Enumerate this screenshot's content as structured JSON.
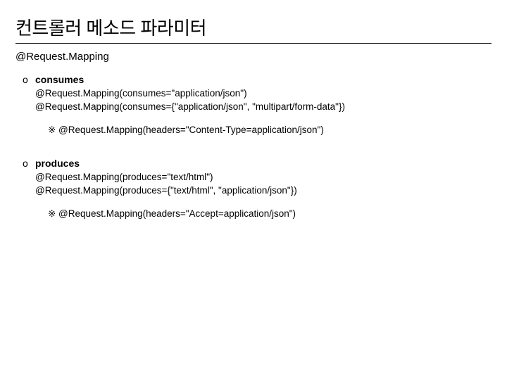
{
  "title": "컨트롤러 메소드 파라미터",
  "subtitle": "@Request.Mapping",
  "sections": [
    {
      "bullet": "o",
      "heading": "consumes",
      "lines": [
        "@Request.Mapping(consumes=\"application/json\")",
        "@Request.Mapping(consumes={\"application/json\", \"multipart/form-data\"})"
      ],
      "note": "※ @Request.Mapping(headers=\"Content-Type=application/json\")"
    },
    {
      "bullet": "o",
      "heading": "produces",
      "lines": [
        "@Request.Mapping(produces=\"text/html\")",
        "@Request.Mapping(produces={\"text/html\", \"application/json\"})"
      ],
      "note": "※ @Request.Mapping(headers=\"Accept=application/json\")"
    }
  ]
}
